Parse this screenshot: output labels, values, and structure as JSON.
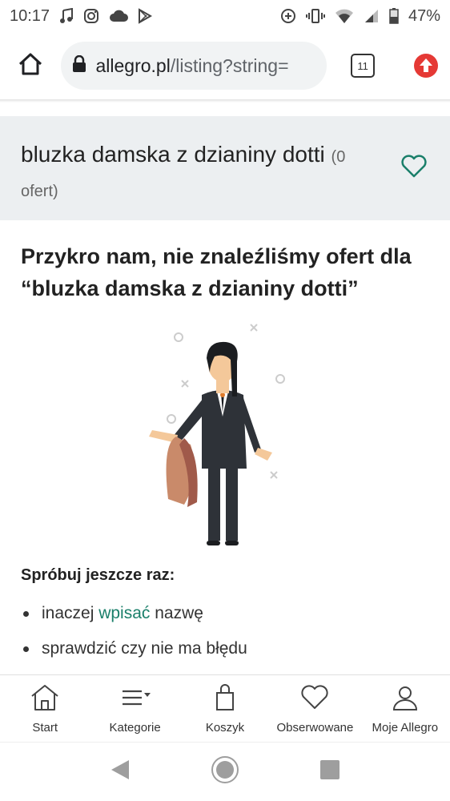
{
  "status_bar": {
    "time": "10:17",
    "battery": "47%",
    "left_icons": [
      "music-note-icon",
      "instagram-icon",
      "cloud-icon",
      "play-store-icon"
    ],
    "right_icons": [
      "data-saver-icon",
      "vibrate-icon",
      "wifi-icon",
      "signal-icon",
      "battery-icon"
    ]
  },
  "browser": {
    "url_host": "allegro.pl",
    "url_path": "/listing?string=",
    "tab_count": "11"
  },
  "search_header": {
    "query": "bluzka damska z dzianiny dotti",
    "offer_count": "(0 ofert)"
  },
  "result": {
    "headline": "Przykro nam, nie znaleźliśmy ofert dla “bluzka damska z dzianiny dotti”"
  },
  "tips": {
    "title": "Spróbuj jeszcze raz:",
    "item1_before": "inaczej ",
    "item1_link": "wpisać",
    "item1_after": " nazwę",
    "item2": "sprawdzić czy nie ma błędu"
  },
  "bottom_nav": {
    "items": [
      {
        "label": "Start"
      },
      {
        "label": "Kategorie"
      },
      {
        "label": "Koszyk"
      },
      {
        "label": "Obserwowane"
      },
      {
        "label": "Moje Allegro"
      }
    ]
  },
  "colors": {
    "accent": "#1a7f6a",
    "panel_bg": "#eceff1",
    "update_red": "#e53935"
  }
}
